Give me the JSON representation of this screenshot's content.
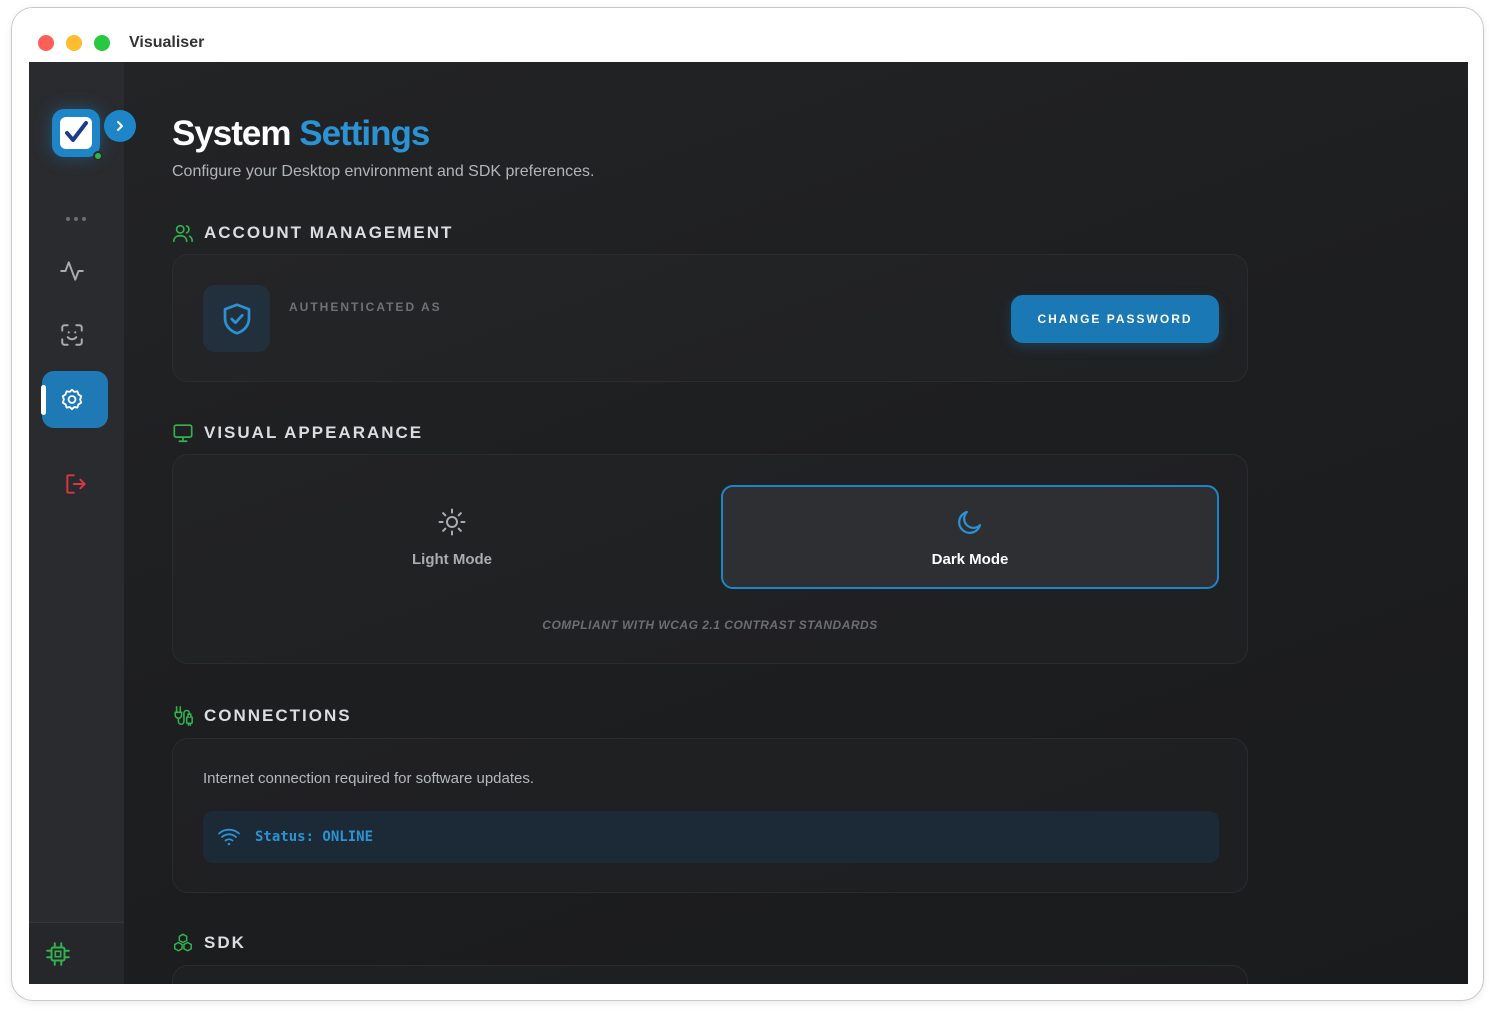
{
  "window": {
    "title": "Visualiser"
  },
  "sidebar": {
    "items": [
      {
        "name": "more",
        "icon": "more-dots-icon"
      },
      {
        "name": "activity",
        "icon": "activity-icon"
      },
      {
        "name": "face-scan",
        "icon": "face-scan-icon"
      },
      {
        "name": "settings",
        "icon": "gear-icon",
        "active": true
      },
      {
        "name": "logout",
        "icon": "logout-icon"
      }
    ],
    "bottom_icon": "cpu-chip-icon"
  },
  "header": {
    "title_main": "System",
    "title_accent": "Settings",
    "subtitle": "Configure your Desktop environment and SDK preferences."
  },
  "account": {
    "heading": "ACCOUNT MANAGEMENT",
    "authenticated_label": "AUTHENTICATED AS",
    "change_password_label": "CHANGE PASSWORD"
  },
  "appearance": {
    "heading": "VISUAL APPEARANCE",
    "light_label": "Light Mode",
    "dark_label": "Dark Mode",
    "selected": "Dark Mode",
    "note": "COMPLIANT WITH WCAG 2.1 CONTRAST STANDARDS"
  },
  "connections": {
    "heading": "CONNECTIONS",
    "description": "Internet connection required for software updates.",
    "status": "Status: ONLINE"
  },
  "sdk": {
    "heading": "SDK"
  },
  "colors": {
    "accent": "#2b93d3",
    "accent_dark": "#1a78b4",
    "section_icon": "#33b24f",
    "logout": "#d7373f",
    "online_dot": "#2fb34a"
  }
}
